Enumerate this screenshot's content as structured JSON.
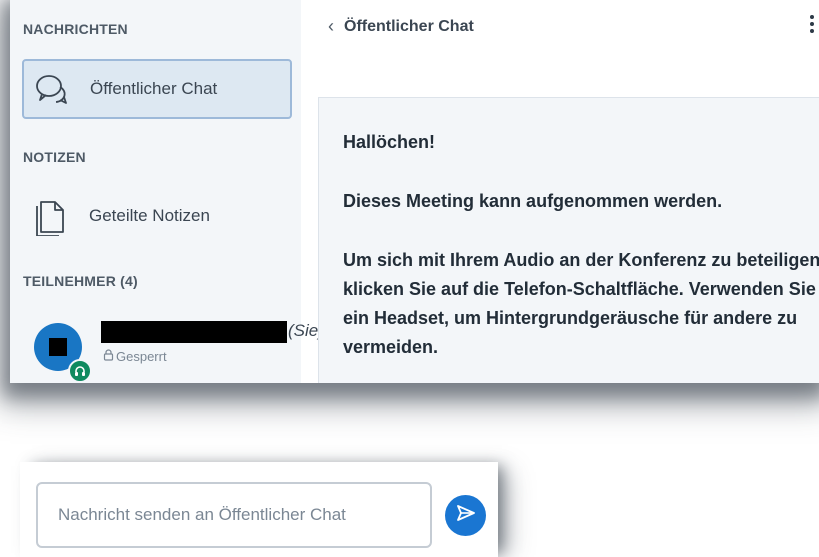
{
  "sidebar": {
    "messages_title": "NACHRICHTEN",
    "public_chat_label": "Öffentlicher Chat",
    "notes_title": "NOTIZEN",
    "shared_notes_label": "Geteilte Notizen",
    "participants_title": "TEILNEHMER (4)",
    "current_user": {
      "you_label": "(Sie)",
      "status": "Gesperrt"
    }
  },
  "chat": {
    "header_title": "Öffentlicher Chat",
    "welcome": {
      "line1": "Hallöchen!",
      "line2": "Dieses Meeting kann aufgenommen werden.",
      "line3": "Um sich mit Ihrem Audio an der Konferenz zu beteiligen, klicken Sie auf die Telefon-Schaltfläche. Verwenden Sie ein Headset, um Hintergrundgeräusche für andere zu vermeiden."
    }
  },
  "composer": {
    "placeholder": "Nachricht senden an Öffentlicher Chat",
    "value": ""
  },
  "colors": {
    "accent": "#1a76d2",
    "avatar": "#1976c4",
    "headset_badge": "#0f8a5f",
    "sidebar_bg": "#f3f6f9",
    "active_item_border": "#9db9d9"
  },
  "icons": [
    "chat-bubbles-icon",
    "document-icon",
    "headset-icon",
    "lock-icon",
    "back-chevron-icon",
    "more-vertical-icon",
    "send-icon"
  ]
}
